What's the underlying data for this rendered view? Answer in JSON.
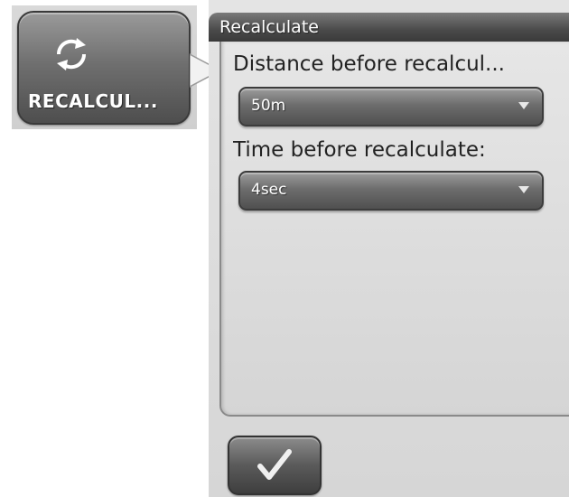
{
  "tile": {
    "label": "RECALCUL...",
    "icon": "recalculate-icon"
  },
  "panel": {
    "title": "Recalculate",
    "fields": [
      {
        "label": "Distance before recalcul...",
        "value": "50m"
      },
      {
        "label": "Time before recalculate:",
        "value": "4sec"
      }
    ]
  },
  "ok_button": {
    "icon": "checkmark-icon"
  },
  "colors": {
    "button_dark": "#505050",
    "panel_bg": "#d9d9d9",
    "text_dark": "#222222",
    "text_light": "#ffffff"
  }
}
